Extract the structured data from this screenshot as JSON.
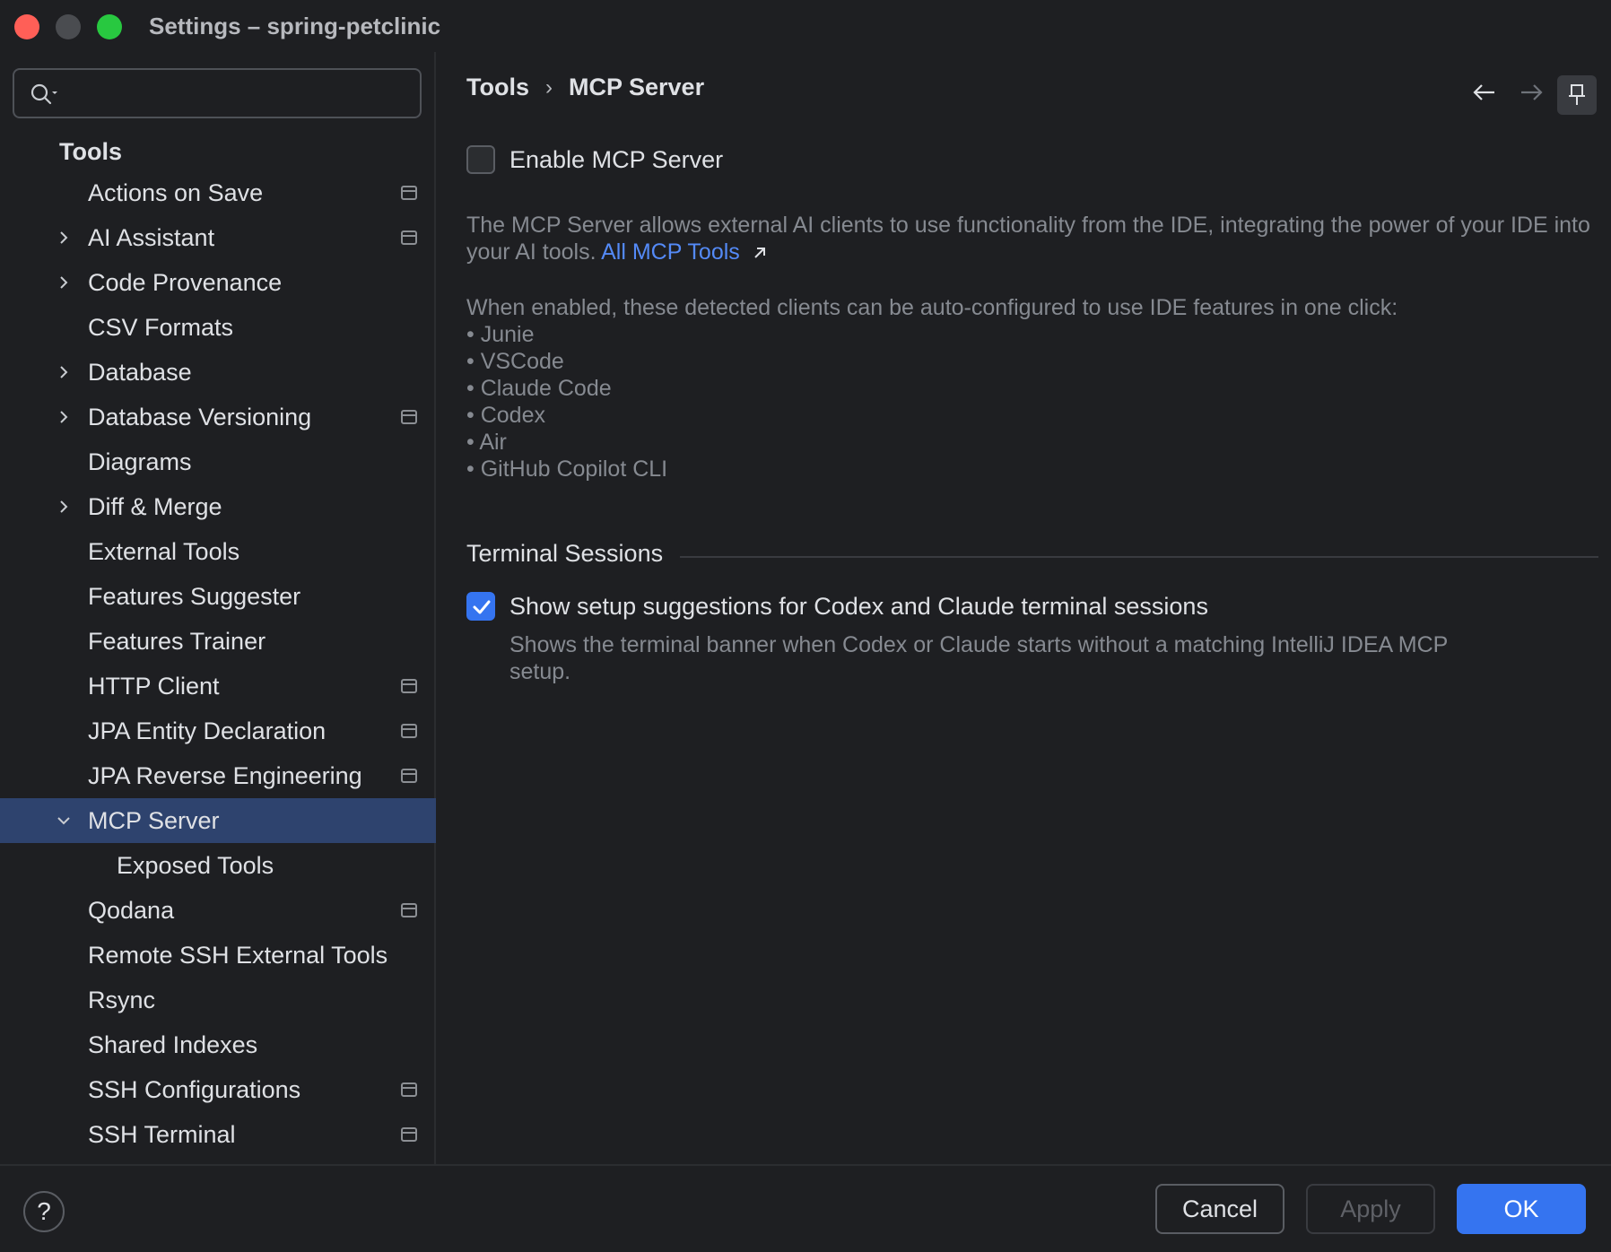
{
  "window": {
    "title": "Settings – spring-petclinic"
  },
  "search": {
    "value": "",
    "placeholder": ""
  },
  "sidebar": {
    "root_label": "Tools",
    "items": [
      {
        "label": "Actions on Save",
        "expander": "none",
        "project_icon": true
      },
      {
        "label": "AI Assistant",
        "expander": "collapsed",
        "project_icon": true
      },
      {
        "label": "Code Provenance",
        "expander": "collapsed",
        "project_icon": false
      },
      {
        "label": "CSV Formats",
        "expander": "none",
        "project_icon": false
      },
      {
        "label": "Database",
        "expander": "collapsed",
        "project_icon": false
      },
      {
        "label": "Database Versioning",
        "expander": "collapsed",
        "project_icon": true
      },
      {
        "label": "Diagrams",
        "expander": "none",
        "project_icon": false
      },
      {
        "label": "Diff & Merge",
        "expander": "collapsed",
        "project_icon": false
      },
      {
        "label": "External Tools",
        "expander": "none",
        "project_icon": false
      },
      {
        "label": "Features Suggester",
        "expander": "none",
        "project_icon": false
      },
      {
        "label": "Features Trainer",
        "expander": "none",
        "project_icon": false
      },
      {
        "label": "HTTP Client",
        "expander": "none",
        "project_icon": true
      },
      {
        "label": "JPA Entity Declaration",
        "expander": "none",
        "project_icon": true
      },
      {
        "label": "JPA Reverse Engineering",
        "expander": "none",
        "project_icon": true
      },
      {
        "label": "MCP Server",
        "expander": "expanded",
        "project_icon": false,
        "selected": true
      },
      {
        "label": "Exposed Tools",
        "expander": "none",
        "project_icon": false,
        "child": true
      },
      {
        "label": "Qodana",
        "expander": "none",
        "project_icon": true
      },
      {
        "label": "Remote SSH External Tools",
        "expander": "none",
        "project_icon": false
      },
      {
        "label": "Rsync",
        "expander": "none",
        "project_icon": false
      },
      {
        "label": "Shared Indexes",
        "expander": "none",
        "project_icon": false
      },
      {
        "label": "SSH Configurations",
        "expander": "none",
        "project_icon": true
      },
      {
        "label": "SSH Terminal",
        "expander": "none",
        "project_icon": true
      }
    ]
  },
  "breadcrumb": {
    "parent": "Tools",
    "separator": "›",
    "current": "MCP Server"
  },
  "main": {
    "enable_checkbox": {
      "label": "Enable MCP Server",
      "checked": false
    },
    "description_text": "The MCP Server allows external AI clients to use functionality from the IDE, integrating the power of your IDE into your AI tools.",
    "description_link": "All MCP Tools",
    "clients_intro": "When enabled, these detected clients can be auto-configured to use IDE features in one click:",
    "clients": [
      "Junie",
      "VSCode",
      "Claude Code",
      "Codex",
      "Air",
      "GitHub Copilot CLI"
    ],
    "terminal_section_title": "Terminal Sessions",
    "terminal_checkbox": {
      "label": "Show setup suggestions for Codex and Claude terminal sessions",
      "checked": true
    },
    "terminal_hint": "Shows the terminal banner when Codex or Claude starts without a matching IntelliJ IDEA MCP setup."
  },
  "footer": {
    "help_label": "?",
    "cancel_label": "Cancel",
    "apply_label": "Apply",
    "ok_label": "OK"
  },
  "colors": {
    "background": "#1e1f22",
    "selection": "#2e436e",
    "accent": "#3574f0",
    "link": "#548af7",
    "muted_text": "#868a91"
  }
}
